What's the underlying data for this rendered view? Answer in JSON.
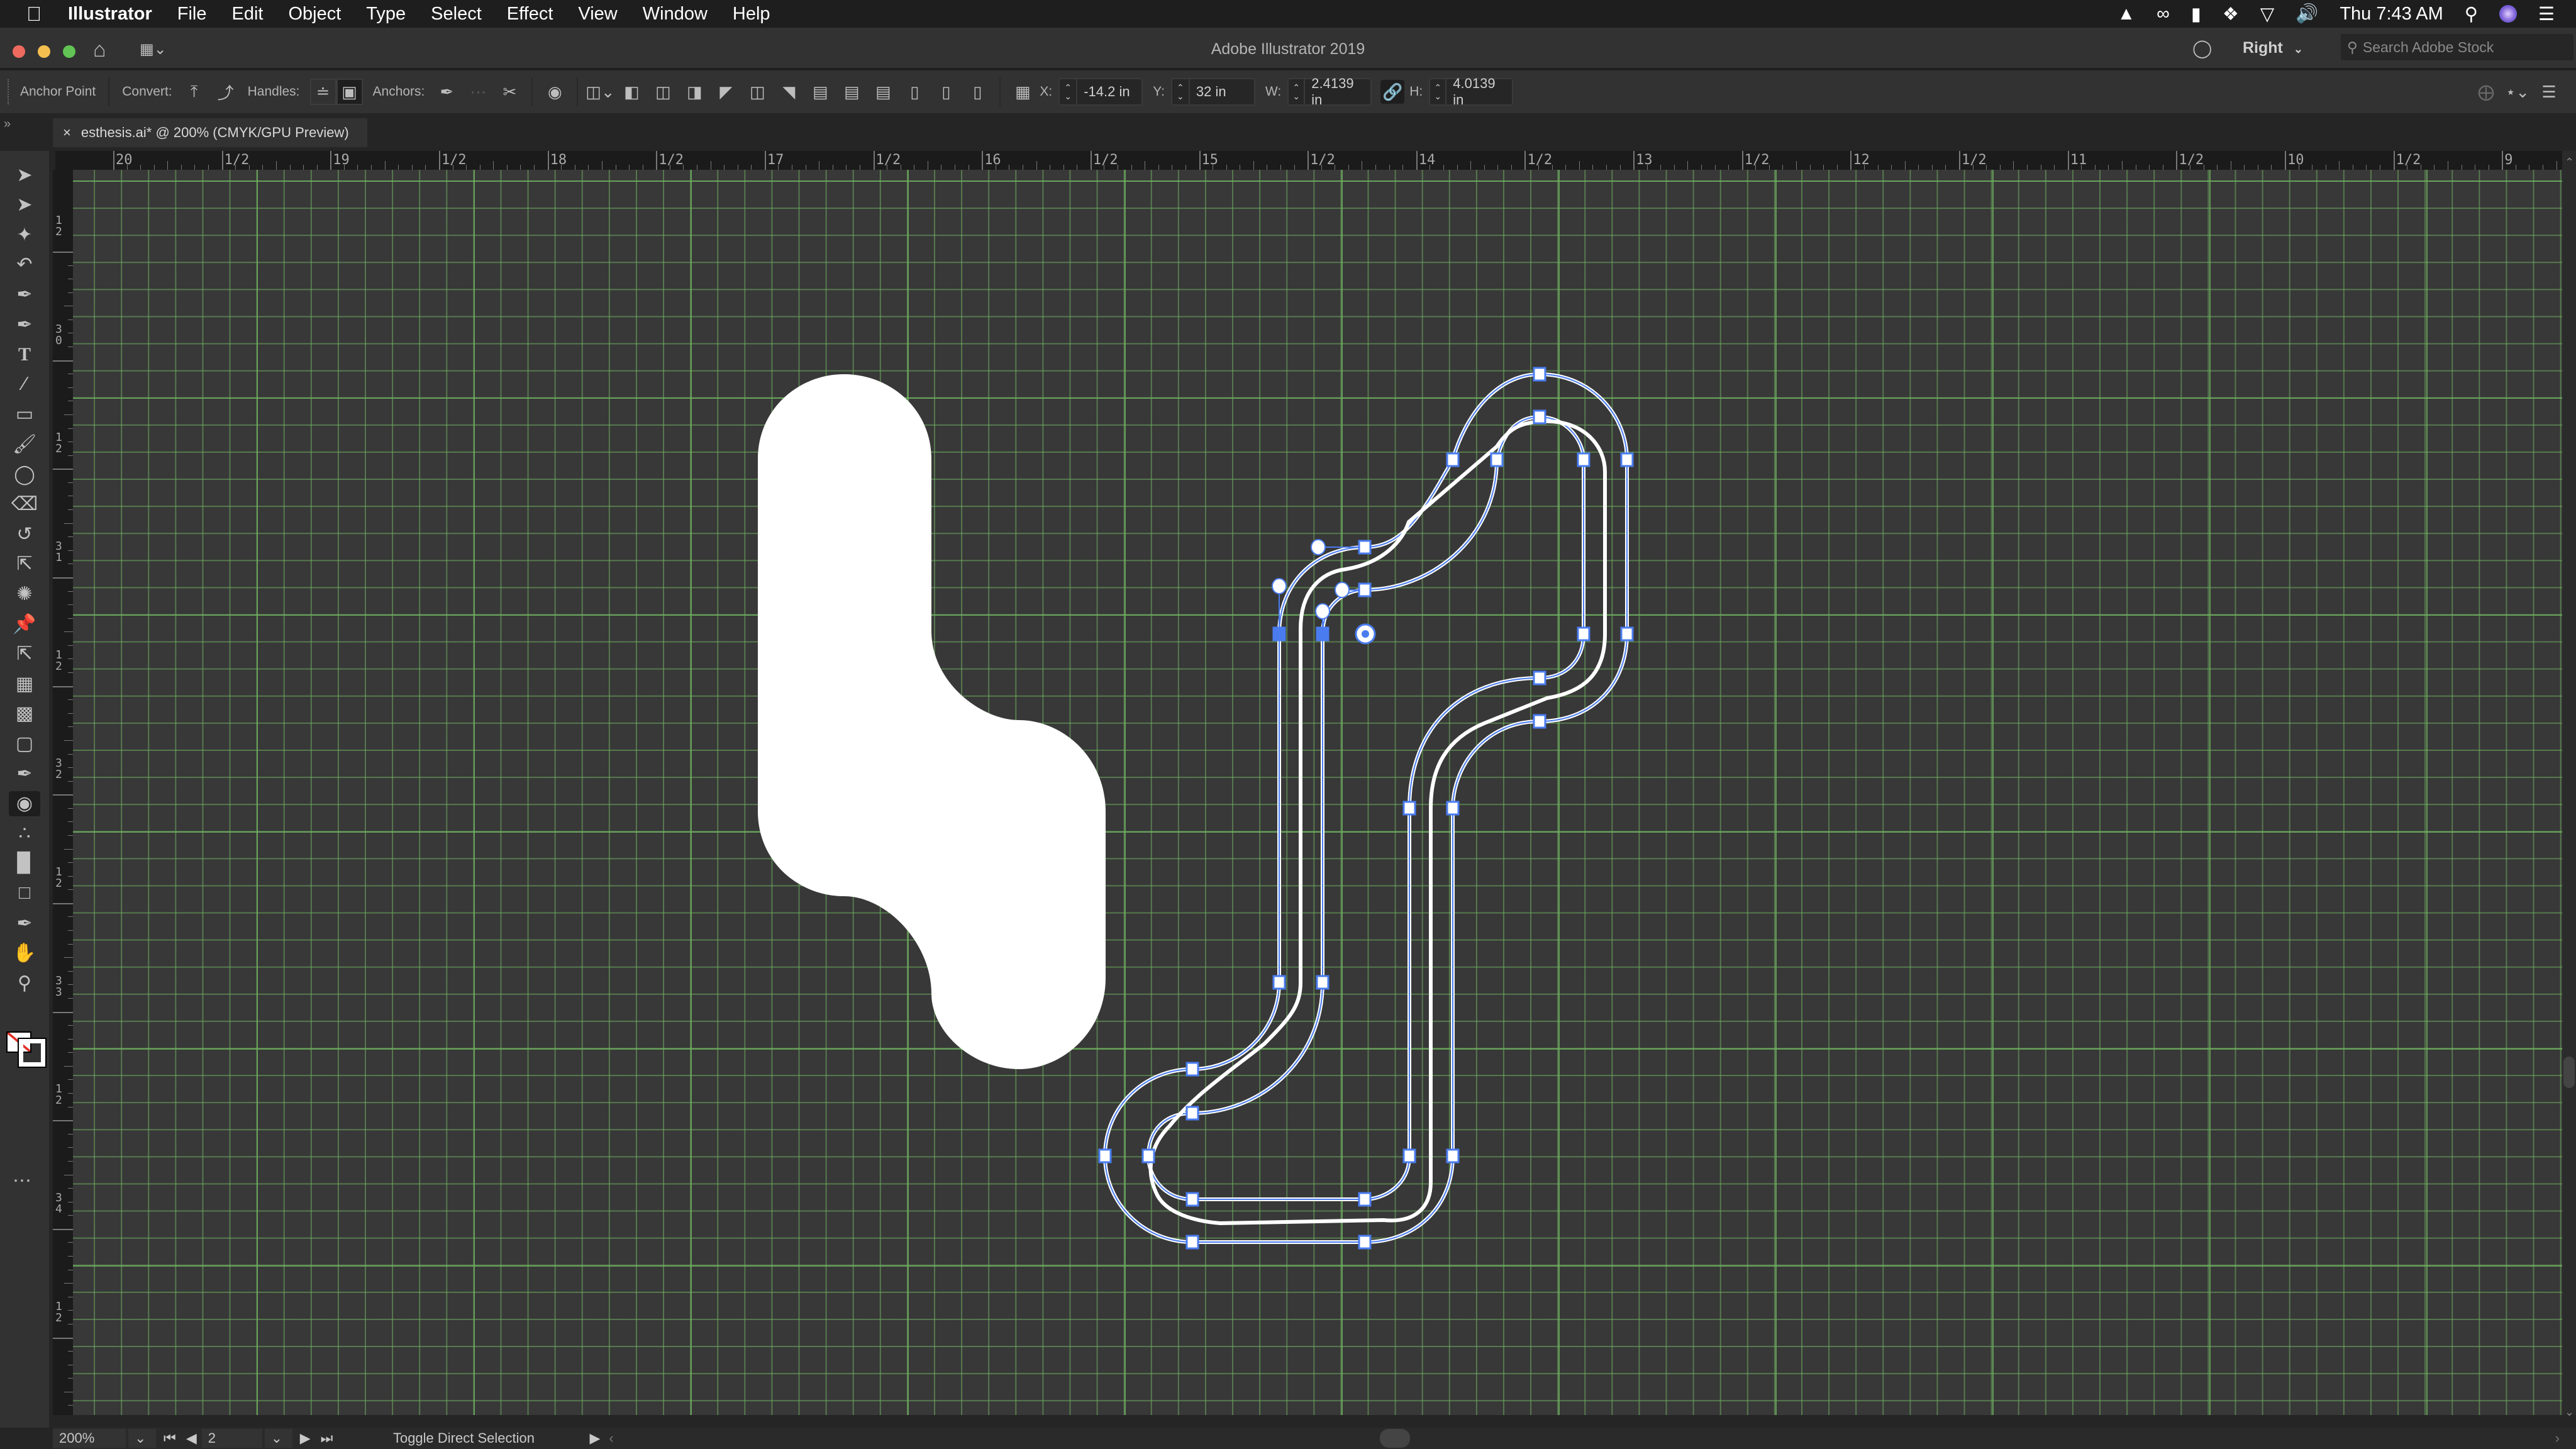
{
  "menubar": {
    "app_name": "Illustrator",
    "items": [
      "File",
      "Edit",
      "Object",
      "Type",
      "Select",
      "Effect",
      "View",
      "Window",
      "Help"
    ],
    "clock": "Thu 7:43 AM",
    "status_icons": [
      "vlc-icon",
      "creative-cloud-icon",
      "display-icon",
      "dropbox-icon",
      "wifi-icon",
      "volume-icon",
      "search-icon",
      "siri-icon",
      "notification-center-icon"
    ]
  },
  "titlebar": {
    "title": "Adobe Illustrator 2019",
    "workspace": "Right",
    "search_placeholder": "Search Adobe Stock"
  },
  "controlbar": {
    "tool_name": "Anchor Point",
    "convert_label": "Convert:",
    "handles_label": "Handles:",
    "anchors_label": "Anchors:",
    "x_label": "X:",
    "x_value": "-14.2 in",
    "y_label": "Y:",
    "y_value": "32 in",
    "w_label": "W:",
    "w_value": "2.4139 in",
    "h_label": "H:",
    "h_value": "4.0139 in"
  },
  "document_tab": {
    "close": "×",
    "title": "esthesis.ai* @ 200% (CMYK/GPU Preview)"
  },
  "rulers": {
    "horizontal": [
      "20",
      "1/2",
      "19",
      "1/2",
      "18",
      "1/2",
      "17",
      "1/2",
      "16",
      "1/2",
      "15",
      "1/2",
      "14",
      "1/2",
      "13",
      "1/2",
      "12",
      "1/2",
      "11",
      "1/2",
      "10",
      "1/2",
      "9"
    ],
    "vertical": [
      "1/2",
      "30",
      "1/2",
      "31",
      "1/2",
      "32",
      "1/2",
      "33",
      "1/2",
      "34",
      "1/2"
    ]
  },
  "tools": [
    "selection-tool",
    "direct-selection-tool",
    "magic-wand-tool",
    "lasso-tool",
    "pen-tool",
    "curvature-tool",
    "type-tool",
    "line-segment-tool",
    "rectangle-tool",
    "paintbrush-tool",
    "shaper-tool",
    "eraser-tool",
    "rotate-tool",
    "scale-tool",
    "puppet-warp-tool",
    "pin-tool",
    "free-transform-tool",
    "perspective-grid-tool",
    "mesh-tool",
    "gradient-tool",
    "eyedropper-tool",
    "shape-builder-tool",
    "symbol-sprayer-tool",
    "column-graph-tool",
    "artboard-tool",
    "slice-tool",
    "hand-tool",
    "zoom-tool"
  ],
  "statusbar": {
    "zoom": "200%",
    "artboard": "2",
    "status_text": "Toggle Direct Selection"
  },
  "colors": {
    "selection": "#4a7cf0",
    "grid": "#6eaf5f",
    "canvas": "#383838",
    "artwork_fill": "#ffffff"
  }
}
